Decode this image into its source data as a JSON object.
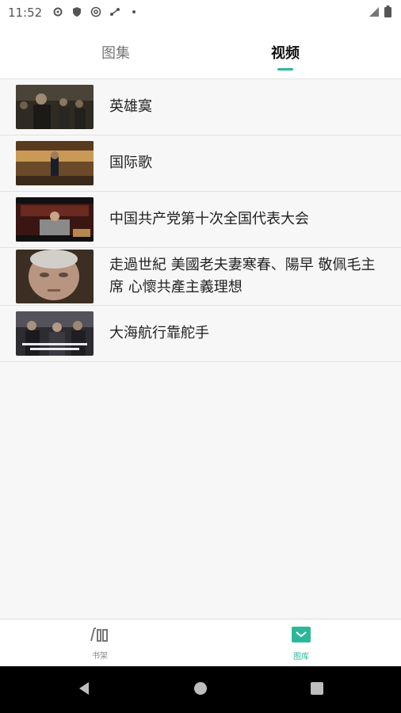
{
  "status_bar": {
    "time": "11:52",
    "icons": [
      "gear-icon",
      "shield-icon",
      "at-sign-icon",
      "share-icon",
      "dot-icon"
    ],
    "right_icons": [
      "signal-icon",
      "battery-icon"
    ]
  },
  "tabs": {
    "left_label": "图集",
    "right_label": "视频",
    "active": "视频",
    "accent_color": "#2db79a"
  },
  "videos": [
    {
      "title": "英雄寞"
    },
    {
      "title": "国际歌"
    },
    {
      "title": "中国共产党第十次全国代表大会"
    },
    {
      "title": "走過世紀 美國老夫妻寒春、陽早 敬佩毛主席 心懷共產主義理想"
    },
    {
      "title": "大海航行靠舵手"
    }
  ],
  "bottom_nav": {
    "bookshelf_label": "书架",
    "gallery_label": "图库",
    "active": "图库",
    "active_color": "#2db79a",
    "inactive_color": "#888888"
  },
  "system_nav": {
    "back": "back-icon",
    "home": "home-icon",
    "recents": "recents-icon"
  }
}
